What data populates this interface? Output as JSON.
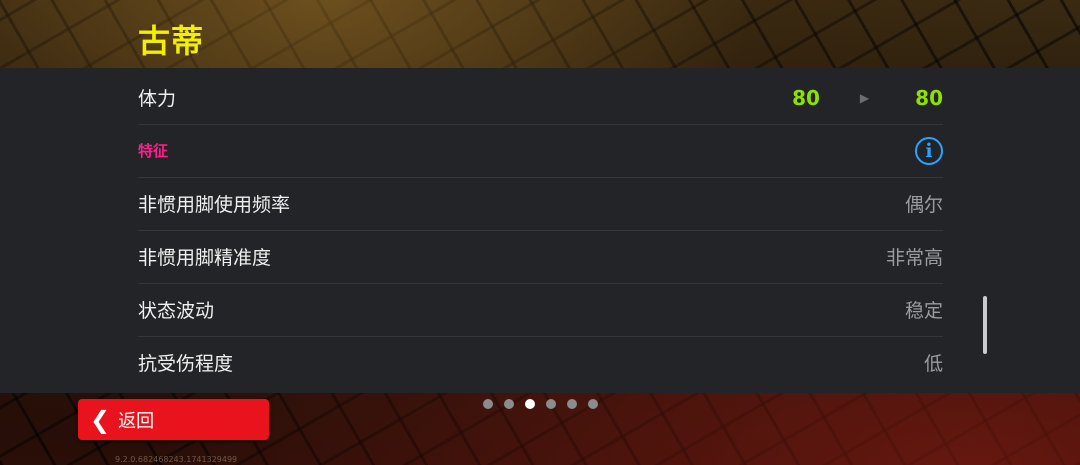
{
  "header": {
    "title": "古蒂"
  },
  "stamina": {
    "label": "体力",
    "current": "80",
    "new": "80"
  },
  "traits": {
    "section_label": "特征",
    "rows": [
      {
        "label": "非惯用脚使用频率",
        "value": "偶尔"
      },
      {
        "label": "非惯用脚精准度",
        "value": "非常高"
      },
      {
        "label": "状态波动",
        "value": "稳定"
      },
      {
        "label": "抗受伤程度",
        "value": "低"
      }
    ]
  },
  "pager": {
    "total": 6,
    "active_index": 2
  },
  "footer": {
    "back_label": "返回",
    "version": "9.2.0.682468243.1741329499"
  },
  "colors": {
    "title": "#f2f000",
    "stat_value": "#8fe000",
    "section_label": "#ff1f8a",
    "info_icon": "#2aa3ff",
    "back_button": "#e8131c"
  },
  "icons": {
    "info": "info-icon",
    "arrow": "arrow-right-icon",
    "back": "chevron-left-icon"
  }
}
